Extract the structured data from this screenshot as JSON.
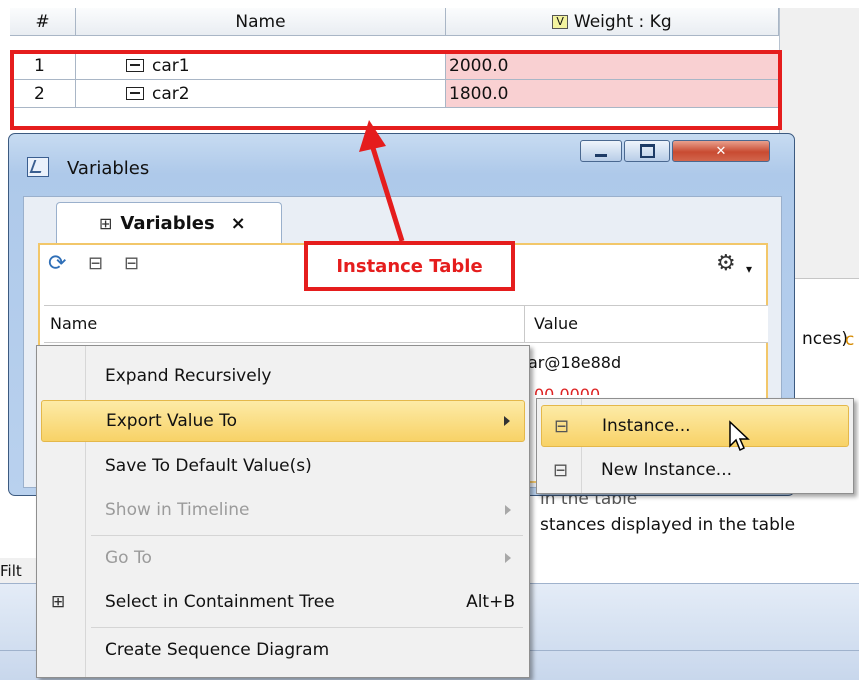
{
  "instance_table": {
    "headers": [
      "#",
      "Name",
      "Weight : Kg"
    ],
    "weight_type_badge": "V",
    "rows": [
      {
        "num": "1",
        "name": "car1",
        "weight": "2000.0"
      },
      {
        "num": "2",
        "name": "car2",
        "weight": "1800.0"
      }
    ],
    "highlight_color": "#f9d0d2"
  },
  "background_fragments": {
    "right_text_1": "nces)",
    "right_text_2": "in the table",
    "right_text_3": "stances displayed in the table",
    "left_text": "Filt"
  },
  "variables_window": {
    "title": "Variables",
    "tab_label": "Variables",
    "tab_close": "×",
    "columns": [
      "Name",
      "Value"
    ],
    "row_values": [
      "ar@18e88d",
      "00.0000"
    ]
  },
  "annotation": {
    "callout_text": "Instance Table",
    "color": "#e51d1d"
  },
  "context_menu": {
    "items": [
      {
        "label": "Expand Recursively",
        "enabled": true
      },
      {
        "label": "Export Value To",
        "enabled": true,
        "submenu": true,
        "highlighted": true
      },
      {
        "label": "Save To Default Value(s)",
        "enabled": true
      },
      {
        "label": "Show in Timeline",
        "enabled": false,
        "submenu": true
      },
      {
        "label": "Go To",
        "enabled": false,
        "submenu": true
      },
      {
        "label": "Select in Containment Tree",
        "enabled": true,
        "shortcut": "Alt+B"
      },
      {
        "label": "Create Sequence Diagram",
        "enabled": true
      }
    ]
  },
  "submenu": {
    "items": [
      {
        "label": "Instance...",
        "highlighted": true
      },
      {
        "label": "New Instance..."
      }
    ]
  }
}
